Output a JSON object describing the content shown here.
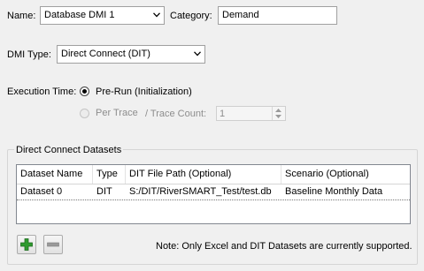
{
  "name": {
    "label": "Name:",
    "value": "Database DMI 1"
  },
  "category": {
    "label": "Category:",
    "value": "Demand"
  },
  "dmi_type": {
    "label": "DMI Type:",
    "value": "Direct Connect (DIT)"
  },
  "execution_time": {
    "label": "Execution Time:",
    "options": [
      {
        "label": "Pre-Run (Initialization)",
        "selected": true,
        "enabled": true
      },
      {
        "label": "Per Trace",
        "selected": false,
        "enabled": false
      }
    ],
    "trace_count_label": "/  Trace Count:",
    "trace_count_value": "1"
  },
  "datasets_group": {
    "title": "Direct Connect Datasets",
    "columns": [
      "Dataset Name",
      "Type",
      "DIT File Path (Optional)",
      "Scenario (Optional)"
    ],
    "rows": [
      [
        "Dataset 0",
        "DIT",
        "S:/DIT/RiverSMART_Test/test.db",
        "Baseline Monthly Data"
      ]
    ],
    "note": "Note: Only Excel and DIT Datasets are currently supported."
  },
  "icons": {
    "add": "plus-icon",
    "remove": "minus-icon",
    "dropdown": "chevron-down-icon"
  },
  "colors": {
    "add_green": "#2e9a2e",
    "remove_gray": "#9a9a9a"
  }
}
